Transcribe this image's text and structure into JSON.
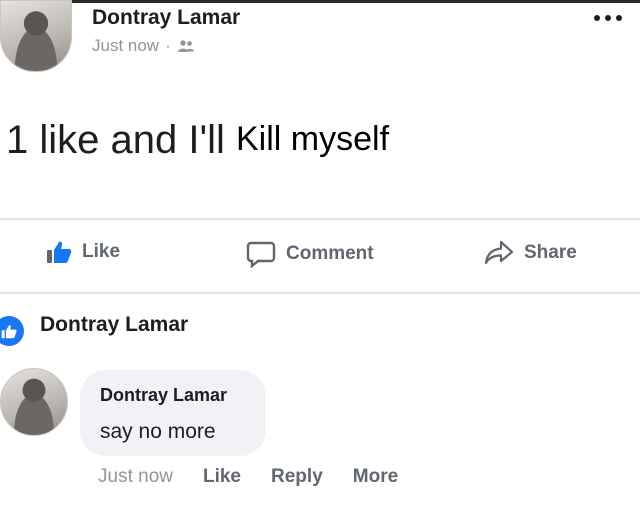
{
  "post": {
    "author": "Dontray Lamar",
    "timestamp": "Just now",
    "separator": "·",
    "audience_icon": "friends-icon",
    "text_part1": "1 like and I'll",
    "text_part2": "Kill myself"
  },
  "actions": {
    "like": "Like",
    "comment": "Comment",
    "share": "Share"
  },
  "comment_section": {
    "commenter_header": "Dontray Lamar",
    "comment": {
      "author": "Dontray Lamar",
      "text": "say no more",
      "timestamp": "Just now",
      "like": "Like",
      "reply": "Reply",
      "more": "More"
    }
  },
  "colors": {
    "accent": "#1877f2",
    "muted_text": "#90949c",
    "action_text": "#606770",
    "bubble_bg": "#f0f2f5"
  }
}
